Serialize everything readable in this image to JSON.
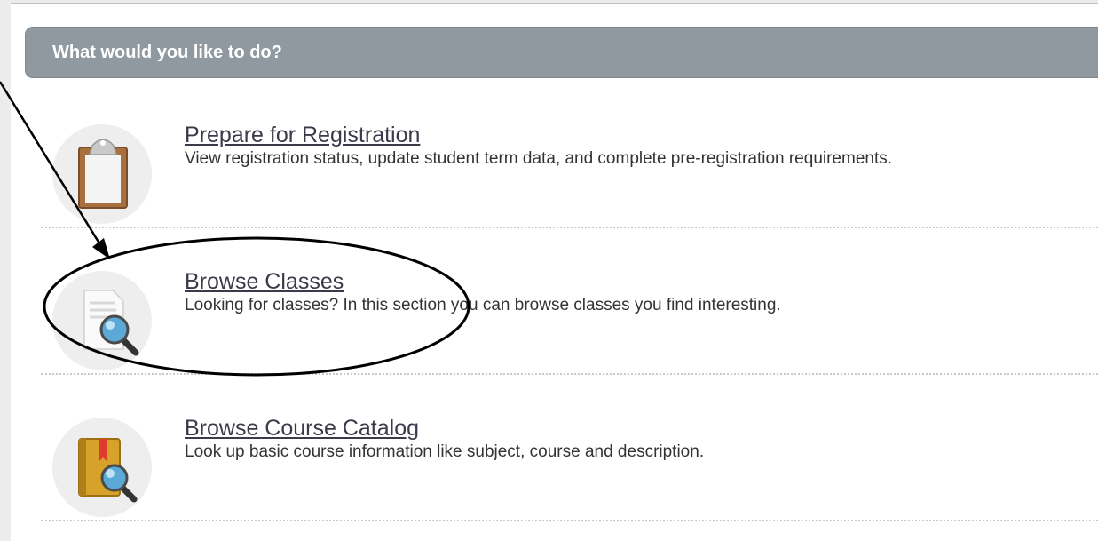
{
  "header": {
    "title": "What would you like to do?"
  },
  "items": [
    {
      "icon": "clipboard-icon",
      "label": "Prepare for Registration",
      "description": "View registration status, update student term data, and complete pre-registration requirements."
    },
    {
      "icon": "document-search-icon",
      "label": "Browse Classes",
      "description": "Looking for classes? In this section you can browse classes you find interesting."
    },
    {
      "icon": "book-search-icon",
      "label": "Browse Course Catalog",
      "description": "Look up basic course information like subject, course and description."
    }
  ],
  "colors": {
    "header_background": "#8f999f",
    "link": "#3a3a4a",
    "annotation": "#000000"
  }
}
